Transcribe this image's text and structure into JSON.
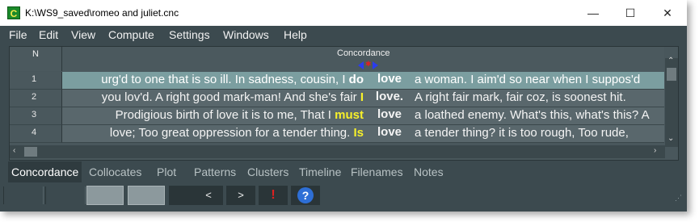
{
  "window": {
    "title": "K:\\WS9_saved\\romeo and juliet.cnc",
    "app_icon_letter": "C",
    "minimize_icon": "minimize-icon",
    "maximize_icon": "maximize-icon",
    "close_icon": "close-icon"
  },
  "menu": {
    "items": [
      "File",
      "Edit",
      "View",
      "Compute",
      "Settings",
      "Windows",
      "Help"
    ]
  },
  "grid": {
    "headers": {
      "n": "N",
      "concordance": "Concordance"
    },
    "rows": [
      {
        "n": "1",
        "left": "urg'd to one that is so ill. In sadness, cousin, I",
        "pre": "do",
        "kw": "love",
        "right": "a woman. I aim'd so near when I suppos'd",
        "selected": true
      },
      {
        "n": "2",
        "left": "you lov'd. A right good mark-man! And she's fair",
        "pre": "I",
        "kw": "love.",
        "right": "A right fair mark, fair coz, is soonest hit.",
        "selected": false
      },
      {
        "n": "3",
        "left": "Prodigious birth of love it is to me, That I",
        "pre": "must",
        "kw": "love",
        "right": "a loathed enemy. What's this, what's this? A",
        "selected": false
      },
      {
        "n": "4",
        "left": "love; Too great oppression for a tender thing.",
        "pre": "Is",
        "kw": "love",
        "right": "a tender thing? it is too rough, Too rude,",
        "selected": false
      }
    ]
  },
  "tabs": [
    "Concordance",
    "Collocates",
    "Plot",
    "Patterns",
    "Clusters",
    "Timeline",
    "Filenames",
    "Notes"
  ],
  "active_tab": "Concordance",
  "statusbar": {
    "prev_label": "<",
    "next_label": ">",
    "alert_label": "!",
    "help_label": "?"
  },
  "colors": {
    "background": "#3c4a4f",
    "selected_row": "#7b9ea0",
    "highlight_yellow": "#f7f02a"
  }
}
